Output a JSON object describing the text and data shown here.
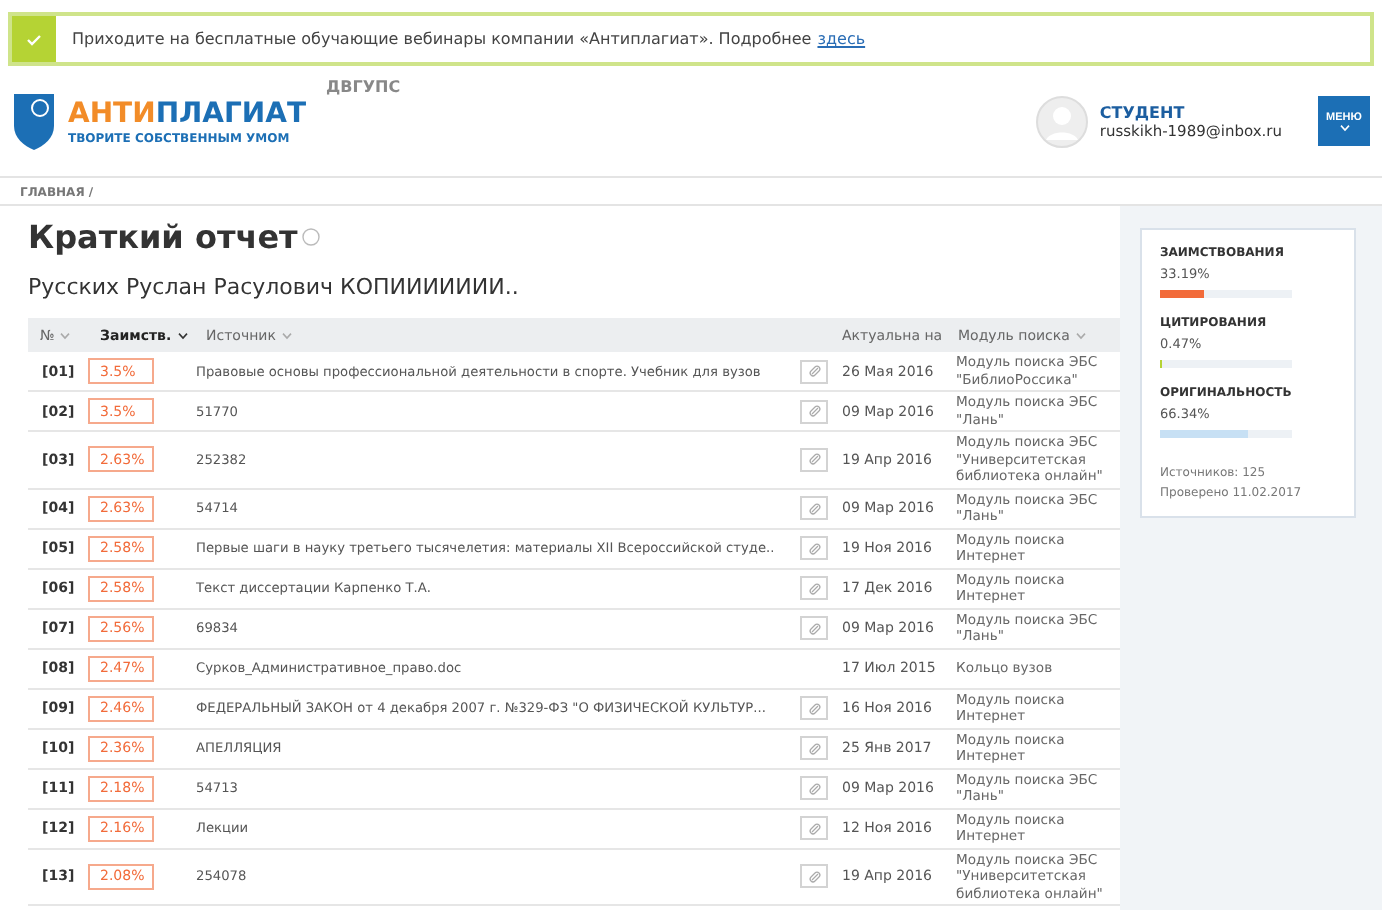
{
  "banner": {
    "text": "Приходите на бесплатные обучающие вебинары компании «Антиплагиат». Подробнее",
    "link": "здесь"
  },
  "header": {
    "logo_part_1": "АНТИ",
    "logo_part_2": "ПЛАГИАТ",
    "tagline": "ТВОРИТЕ СОБСТВЕННЫМ УМОМ",
    "org": "ДВГУПС",
    "user_role": "СТУДЕНТ",
    "user_email": "russkikh-1989@inbox.ru",
    "menu_button": "МЕНЮ"
  },
  "breadcrumb": "ГЛАВНАЯ /",
  "report": {
    "title": "Краткий отчет",
    "subtitle": "Русских Руслан Расулович КОПИИИИИИИ.."
  },
  "table": {
    "columns": [
      {
        "label": "№",
        "selected": false
      },
      {
        "label": "Заимств.",
        "selected": true
      },
      {
        "label": "Источник",
        "selected": false
      },
      {
        "label": "Актуальна на",
        "selected": false
      },
      {
        "label": "Модуль поиска",
        "selected": false
      }
    ],
    "rows": [
      {
        "num": "[01]",
        "share": "3.5%",
        "source": "Правовые основы профессиональной деятельности в спорте. Учебник для вузов",
        "link": true,
        "date": "26 Мая 2016",
        "module": "Модуль поиска ЭБС \"БиблиоРоссика\""
      },
      {
        "num": "[02]",
        "share": "3.5%",
        "source": "51770",
        "link": true,
        "date": "09 Мар 2016",
        "module": "Модуль поиска ЭБС \"Лань\""
      },
      {
        "num": "[03]",
        "share": "2.63%",
        "source": "252382",
        "link": true,
        "date": "19 Апр 2016",
        "module": "Модуль поиска ЭБС \"Университетская библиотека онлайн\""
      },
      {
        "num": "[04]",
        "share": "2.63%",
        "source": "54714",
        "link": true,
        "date": "09 Мар 2016",
        "module": "Модуль поиска ЭБС \"Лань\""
      },
      {
        "num": "[05]",
        "share": "2.58%",
        "source": "Первые шаги в науку третьего тысячелетия: материалы XII Всероссийской студе..",
        "link": true,
        "date": "19 Ноя 2016",
        "module": "Модуль поиска Интернет"
      },
      {
        "num": "[06]",
        "share": "2.58%",
        "source": "Текст диссертации Карпенко Т.А.",
        "link": true,
        "date": "17 Дек 2016",
        "module": "Модуль поиска Интернет"
      },
      {
        "num": "[07]",
        "share": "2.56%",
        "source": "69834",
        "link": true,
        "date": "09 Мар 2016",
        "module": "Модуль поиска ЭБС \"Лань\""
      },
      {
        "num": "[08]",
        "share": "2.47%",
        "source": "Сурков_Административное_право.doc",
        "link": false,
        "date": "17 Июл 2015",
        "module": "Кольцо вузов"
      },
      {
        "num": "[09]",
        "share": "2.46%",
        "source": "ФЕДЕРАЛЬНЫЙ ЗАКОН от 4 декабря 2007 г. №329-ФЗ \"О ФИЗИЧЕСКОЙ КУЛЬТУР...",
        "link": true,
        "date": "16 Ноя 2016",
        "module": "Модуль поиска Интернет"
      },
      {
        "num": "[10]",
        "share": "2.36%",
        "source": "АПЕЛЛЯЦИЯ",
        "link": true,
        "date": "25 Янв 2017",
        "module": "Модуль поиска Интернет"
      },
      {
        "num": "[11]",
        "share": "2.18%",
        "source": "54713",
        "link": true,
        "date": "09 Мар 2016",
        "module": "Модуль поиска ЭБС \"Лань\""
      },
      {
        "num": "[12]",
        "share": "2.16%",
        "source": "Лекции",
        "link": true,
        "date": "12 Ноя 2016",
        "module": "Модуль поиска Интернет"
      },
      {
        "num": "[13]",
        "share": "2.08%",
        "source": "254078",
        "link": true,
        "date": "19 Апр 2016",
        "module": "Модуль поиска ЭБС \"Университетская библиотека онлайн\""
      }
    ]
  },
  "summary": {
    "metrics": [
      {
        "label": "ЗАИМСТВОВАНИЯ",
        "value": "33.19%",
        "level": 0.3319,
        "color": "#f26b3a"
      },
      {
        "label": "ЦИТИРОВАНИЯ",
        "value": "0.47%",
        "level": 0.0047,
        "color": "#b5d334"
      },
      {
        "label": "ОРИГИНАЛЬНОСТЬ",
        "value": "66.34%",
        "level": 0.6634,
        "color": "#c7e0f4"
      }
    ],
    "sources": "Источников: 125",
    "checked": "Проверено 11.02.2017"
  }
}
